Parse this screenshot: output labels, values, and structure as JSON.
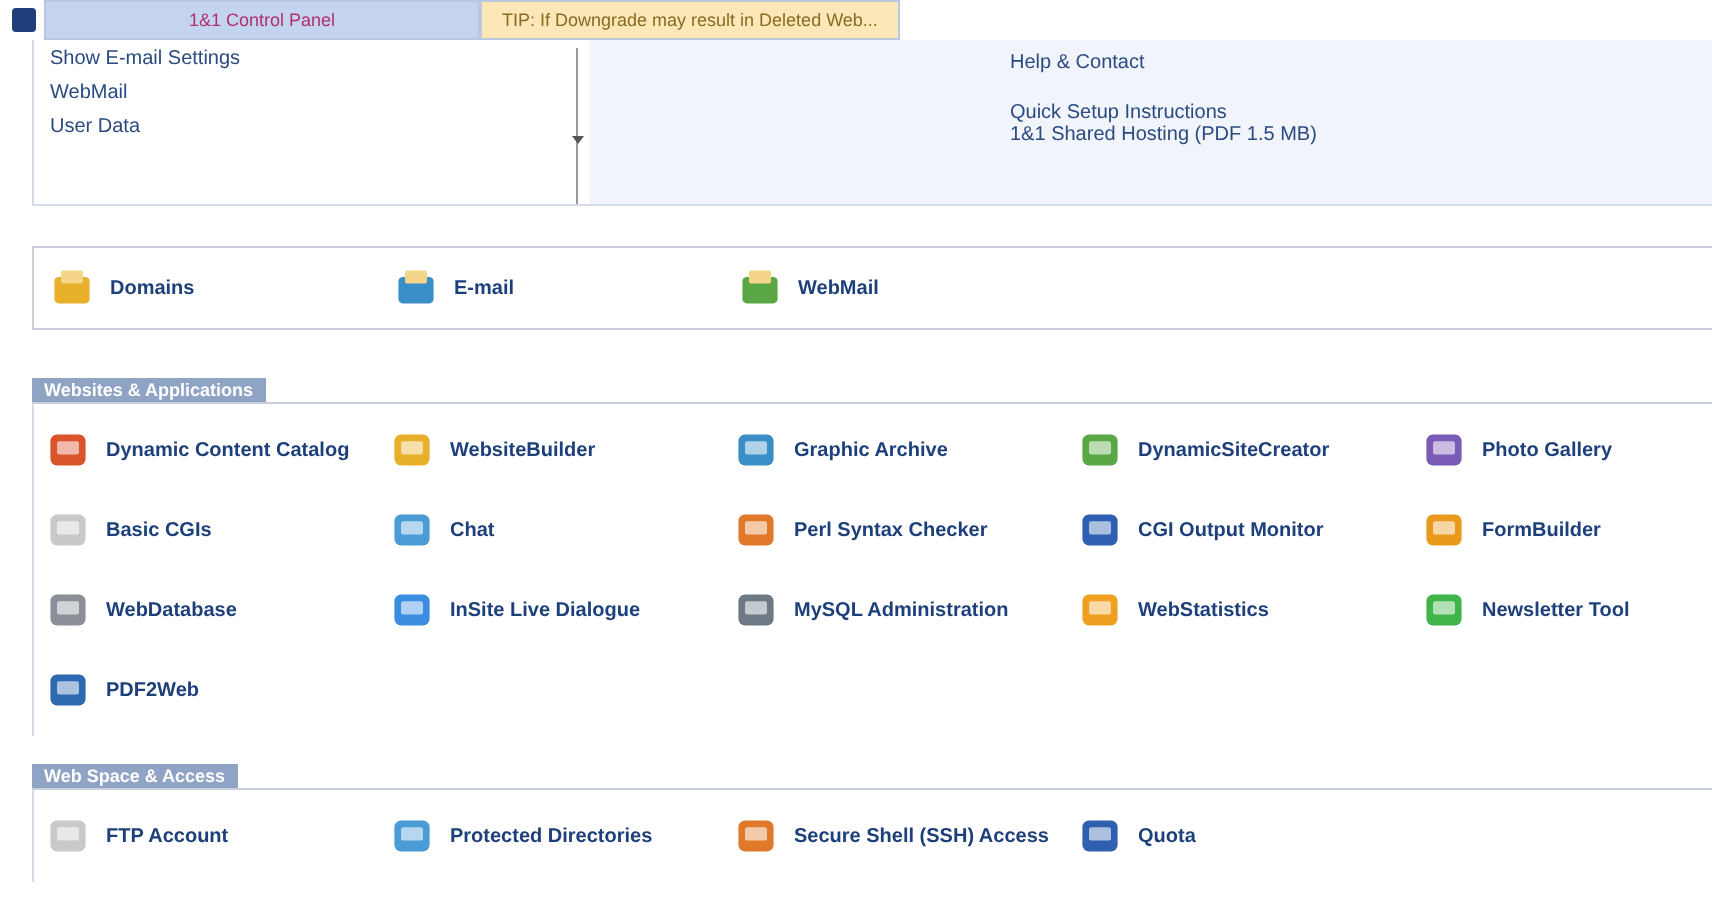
{
  "tabs": [
    {
      "label": "1&1 Control Panel",
      "selected": true
    },
    {
      "label": "TIP: If Downgrade may result in Deleted Web...",
      "selected": false
    }
  ],
  "quick_links": {
    "left": [
      "Show E-mail Settings",
      "WebMail",
      "User Data"
    ],
    "right": [
      "Help & Contact"
    ],
    "help": [
      "Quick Setup Instructions",
      "1&1 Shared Hosting (PDF 1.5 MB)"
    ]
  },
  "main_tools": [
    "Domains",
    "E-mail",
    "WebMail"
  ],
  "sections": [
    {
      "title": "Websites & Applications",
      "items": [
        "Dynamic Content Catalog",
        "WebsiteBuilder",
        "Graphic Archive",
        "DynamicSiteCreator",
        "Photo Gallery",
        "Basic CGIs",
        "Chat",
        "Perl Syntax Checker",
        "CGI Output Monitor",
        "FormBuilder",
        "WebDatabase",
        "InSite Live Dialogue",
        "MySQL Administration",
        "WebStatistics",
        "Newsletter Tool",
        "PDF2Web"
      ]
    },
    {
      "title": "Web Space & Access",
      "items": [
        "FTP Account",
        "Protected Directories",
        "Secure Shell (SSH) Access",
        "Quota"
      ]
    }
  ]
}
